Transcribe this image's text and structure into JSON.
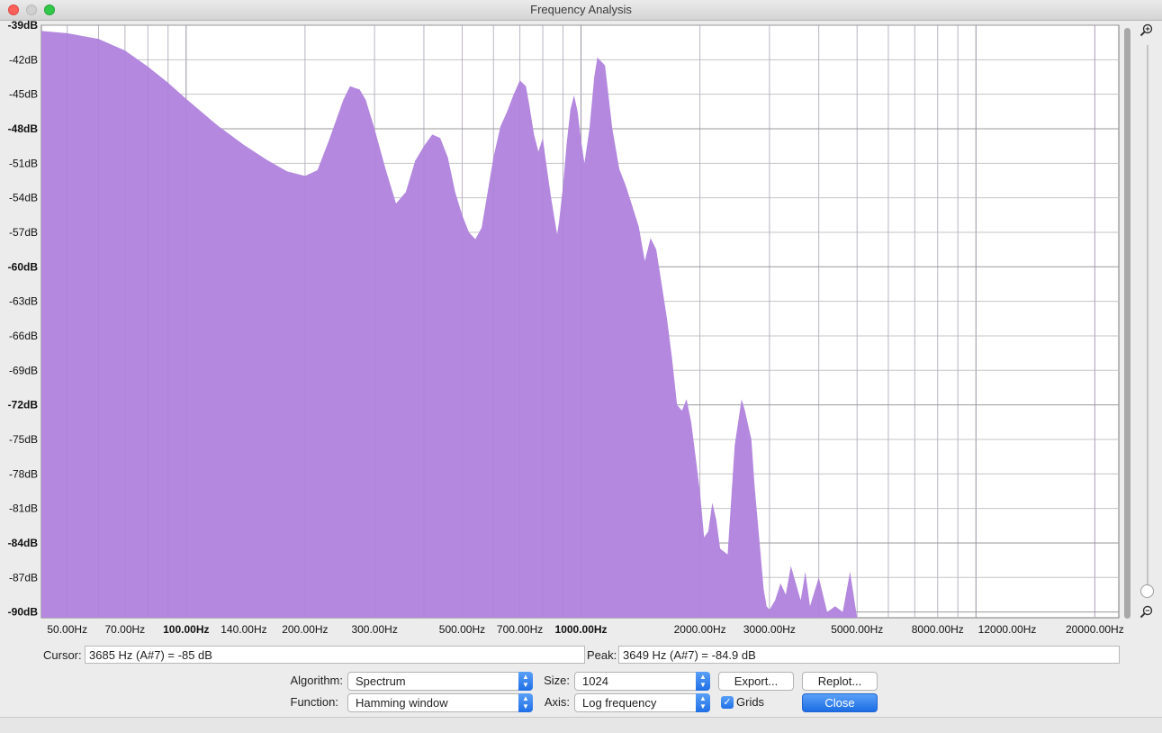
{
  "window": {
    "title": "Frequency Analysis"
  },
  "plot": {
    "y_ticks": [
      {
        "label": "-39dB",
        "db": -39,
        "major": true
      },
      {
        "label": "-42dB",
        "db": -42,
        "major": false
      },
      {
        "label": "-45dB",
        "db": -45,
        "major": false
      },
      {
        "label": "-48dB",
        "db": -48,
        "major": true
      },
      {
        "label": "-51dB",
        "db": -51,
        "major": false
      },
      {
        "label": "-54dB",
        "db": -54,
        "major": false
      },
      {
        "label": "-57dB",
        "db": -57,
        "major": false
      },
      {
        "label": "-60dB",
        "db": -60,
        "major": true
      },
      {
        "label": "-63dB",
        "db": -63,
        "major": false
      },
      {
        "label": "-66dB",
        "db": -66,
        "major": false
      },
      {
        "label": "-69dB",
        "db": -69,
        "major": false
      },
      {
        "label": "-72dB",
        "db": -72,
        "major": true
      },
      {
        "label": "-75dB",
        "db": -75,
        "major": false
      },
      {
        "label": "-78dB",
        "db": -78,
        "major": false
      },
      {
        "label": "-81dB",
        "db": -81,
        "major": false
      },
      {
        "label": "-84dB",
        "db": -84,
        "major": true
      },
      {
        "label": "-87dB",
        "db": -87,
        "major": false
      },
      {
        "label": "-90dB",
        "db": -90,
        "major": true
      }
    ],
    "x_ticks": [
      {
        "label": "50.00Hz",
        "hz": 50,
        "major": false
      },
      {
        "label": "70.00Hz",
        "hz": 70,
        "major": false
      },
      {
        "label": "100.00Hz",
        "hz": 100,
        "major": true
      },
      {
        "label": "140.00Hz",
        "hz": 140,
        "major": false
      },
      {
        "label": "200.00Hz",
        "hz": 200,
        "major": false
      },
      {
        "label": "300.00Hz",
        "hz": 300,
        "major": false
      },
      {
        "label": "500.00Hz",
        "hz": 500,
        "major": false
      },
      {
        "label": "700.00Hz",
        "hz": 700,
        "major": false
      },
      {
        "label": "1000.00Hz",
        "hz": 1000,
        "major": true
      },
      {
        "label": "2000.00Hz",
        "hz": 2000,
        "major": false
      },
      {
        "label": "3000.00Hz",
        "hz": 3000,
        "major": false
      },
      {
        "label": "5000.00Hz",
        "hz": 5000,
        "major": false
      },
      {
        "label": "8000.00Hz",
        "hz": 8000,
        "major": false
      },
      {
        "label": "12000.00Hz",
        "hz": 12000,
        "major": false
      },
      {
        "label": "20000.00Hz",
        "hz": 20000,
        "major": false
      }
    ],
    "x_range_hz": [
      43,
      23000
    ],
    "y_range_db": [
      -90.5,
      -39
    ],
    "colors": {
      "fill": "#b388de",
      "grid": "#c4c4c4",
      "grid_major": "#9a9a9a",
      "background": "#ffffff"
    }
  },
  "chart_data": {
    "type": "area",
    "xlabel": "",
    "ylabel": "",
    "x_scale": "log",
    "xlim": [
      43,
      23000
    ],
    "ylim": [
      -90.5,
      -39
    ],
    "grid": true,
    "series": [
      {
        "x": [
          43,
          50,
          60,
          70,
          80,
          90,
          100,
          120,
          140,
          160,
          180,
          200,
          215,
          230,
          250,
          260,
          275,
          285,
          300,
          320,
          340,
          360,
          380,
          400,
          420,
          440,
          460,
          480,
          500,
          520,
          540,
          560,
          580,
          600,
          625,
          650,
          675,
          700,
          725,
          740,
          760,
          780,
          800,
          820,
          840,
          870,
          880,
          900,
          920,
          940,
          960,
          980,
          1000,
          1020,
          1050,
          1080,
          1100,
          1150,
          1200,
          1250,
          1300,
          1400,
          1450,
          1500,
          1550,
          1600,
          1650,
          1700,
          1750,
          1800,
          1850,
          1900,
          1950,
          2000,
          2050,
          2100,
          2150,
          2200,
          2250,
          2350,
          2450,
          2550,
          2600,
          2700,
          2750,
          2850,
          2900,
          2950,
          3000,
          3100,
          3200,
          3300,
          3400,
          3600,
          3700,
          3800,
          4000,
          4200,
          4400,
          4600,
          4800,
          5000,
          5100
        ],
        "values": [
          -39.5,
          -39.7,
          -40.2,
          -41.2,
          -42.6,
          -44.0,
          -45.4,
          -47.7,
          -49.4,
          -50.7,
          -51.7,
          -52.1,
          -51.6,
          -49.0,
          -45.5,
          -44.3,
          -44.6,
          -45.5,
          -48.0,
          -51.5,
          -54.5,
          -53.5,
          -50.8,
          -49.5,
          -48.5,
          -48.8,
          -50.5,
          -53.5,
          -55.5,
          -57.0,
          -57.6,
          -56.6,
          -53.5,
          -50.5,
          -47.8,
          -46.5,
          -45.0,
          -43.8,
          -44.3,
          -46.0,
          -48.5,
          -50.0,
          -48.8,
          -51.5,
          -54.0,
          -57.2,
          -56.0,
          -53.0,
          -49.2,
          -46.3,
          -45.1,
          -46.5,
          -49.0,
          -51.0,
          -48.0,
          -43.5,
          -41.8,
          -42.5,
          -48.0,
          -51.5,
          -53.0,
          -56.5,
          -59.5,
          -57.5,
          -58.5,
          -61.5,
          -64.5,
          -68.0,
          -72.0,
          -72.5,
          -71.5,
          -73.5,
          -76.5,
          -79.5,
          -83.5,
          -83.0,
          -80.5,
          -82.0,
          -84.5,
          -85.0,
          -75.5,
          -71.5,
          -72.5,
          -75.0,
          -79.0,
          -85.0,
          -88.0,
          -89.5,
          -89.8,
          -89.0,
          -87.5,
          -88.5,
          -86.0,
          -89.0,
          -86.5,
          -89.5,
          -87.0,
          -90.0,
          -89.5,
          -90.0,
          -86.5,
          -90.5,
          -90.5
        ]
      }
    ]
  },
  "cursor": {
    "label": "Cursor:",
    "value": "3685 Hz (A#7) = -85 dB"
  },
  "peak": {
    "label": "Peak:",
    "value": "3649 Hz (A#7) = -84.9 dB"
  },
  "controls": {
    "algorithm_label": "Algorithm:",
    "algorithm_value": "Spectrum",
    "function_label": "Function:",
    "function_value": "Hamming window",
    "size_label": "Size:",
    "size_value": "1024",
    "axis_label": "Axis:",
    "axis_value": "Log frequency",
    "export_label": "Export...",
    "replot_label": "Replot...",
    "grids_label": "Grids",
    "grids_checked": true,
    "close_label": "Close"
  },
  "icons": {
    "zoom_in": "zoom-in-icon",
    "zoom_out": "zoom-out-icon",
    "checkmark": "✓"
  }
}
